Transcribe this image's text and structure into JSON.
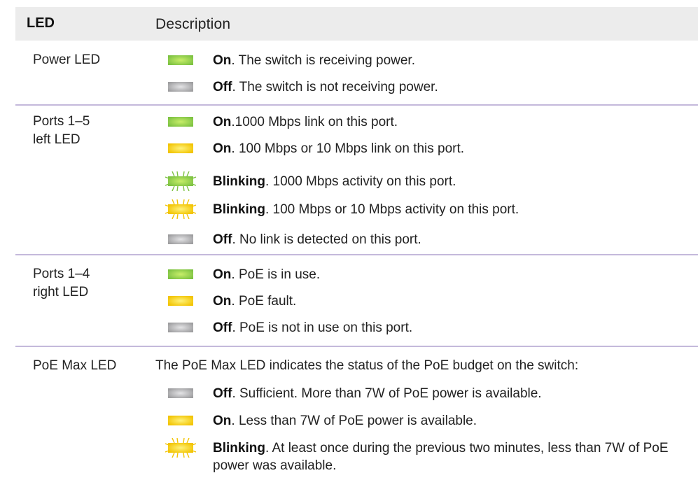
{
  "header": {
    "led": "LED",
    "description": "Description"
  },
  "colors": {
    "green": "#7dc242",
    "yellow": "#f2c300",
    "gray": "#9e9ea0",
    "separator": "#c4b9db",
    "header_bg": "#ececec"
  },
  "rows": [
    {
      "name": [
        "Power LED"
      ],
      "entries": [
        {
          "icon": "led-green-solid",
          "bold": "On",
          "text": ". The switch is receiving power."
        },
        {
          "icon": "led-gray-off",
          "bold": "Off",
          "text": ". The switch is not receiving power."
        }
      ]
    },
    {
      "name": [
        "Ports 1–5",
        "left LED"
      ],
      "entries": [
        {
          "icon": "led-green-solid",
          "bold": "On",
          "text": ".1000 Mbps link on this port."
        },
        {
          "icon": "led-yellow-solid",
          "bold": "On",
          "text": ". 100 Mbps or 10 Mbps link on this port."
        },
        {
          "icon": "led-green-blinking",
          "bold": "Blinking",
          "text": ". 1000 Mbps activity on this port."
        },
        {
          "icon": "led-yellow-blinking",
          "bold": "Blinking",
          "text": ". 100 Mbps or 10 Mbps activity on this port."
        },
        {
          "icon": "led-gray-off",
          "bold": "Off",
          "text": ". No link is detected on this port."
        }
      ]
    },
    {
      "name": [
        "Ports 1–4",
        "right LED"
      ],
      "entries": [
        {
          "icon": "led-green-solid",
          "bold": "On",
          "text": ". PoE is in use."
        },
        {
          "icon": "led-yellow-solid",
          "bold": "On",
          "text": ". PoE fault."
        },
        {
          "icon": "led-gray-off",
          "bold": "Off",
          "text": ". PoE is not in use on this port."
        }
      ]
    },
    {
      "name": [
        "PoE Max LED"
      ],
      "intro": "The PoE Max LED indicates the status of the PoE budget on the switch:",
      "entries": [
        {
          "icon": "led-gray-off",
          "bold": "Off",
          "text": ". Sufficient. More than 7W of PoE power is available."
        },
        {
          "icon": "led-yellow-solid",
          "bold": "On",
          "text": ". Less than 7W of PoE power is available."
        },
        {
          "icon": "led-yellow-blinking",
          "bold": "Blinking",
          "text": ". At least once during the previous two minutes, less than 7W of PoE power was available."
        }
      ]
    }
  ]
}
